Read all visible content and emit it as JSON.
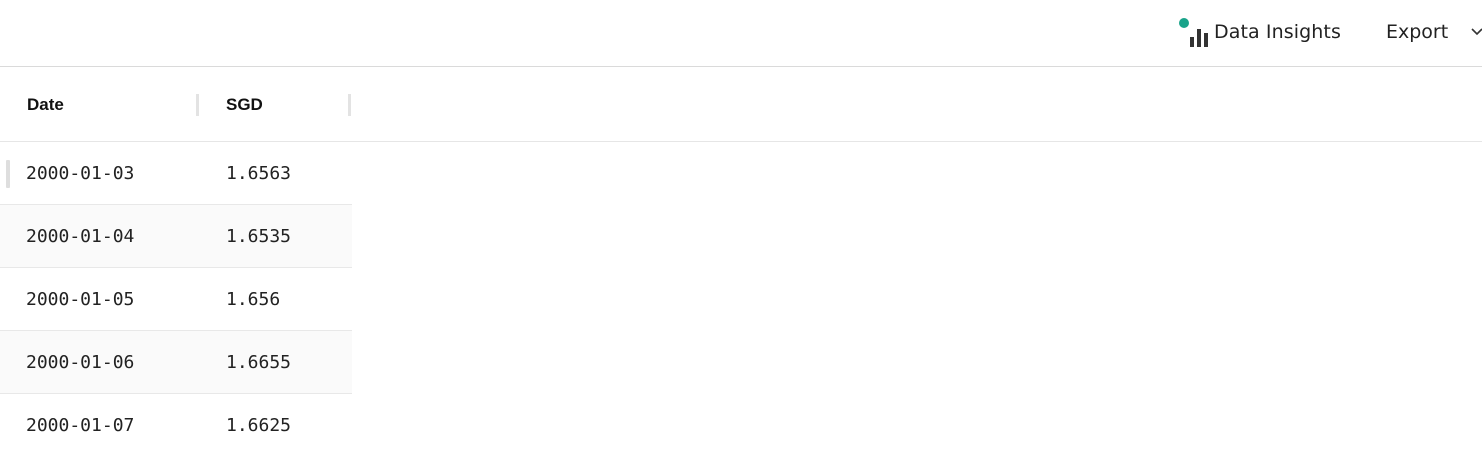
{
  "toolbar": {
    "insights_label": "Data Insights",
    "insights_icon": "bar-chart-icon",
    "insights_dot_color": "#19a38a",
    "export_label": "Export",
    "export_icon": "chevron-down-icon"
  },
  "table": {
    "columns": [
      "Date",
      "SGD"
    ],
    "rows": [
      {
        "date": "2000-01-03",
        "sgd": "1.6563"
      },
      {
        "date": "2000-01-04",
        "sgd": "1.6535"
      },
      {
        "date": "2000-01-05",
        "sgd": "1.656"
      },
      {
        "date": "2000-01-06",
        "sgd": "1.6655"
      },
      {
        "date": "2000-01-07",
        "sgd": "1.6625"
      }
    ]
  }
}
